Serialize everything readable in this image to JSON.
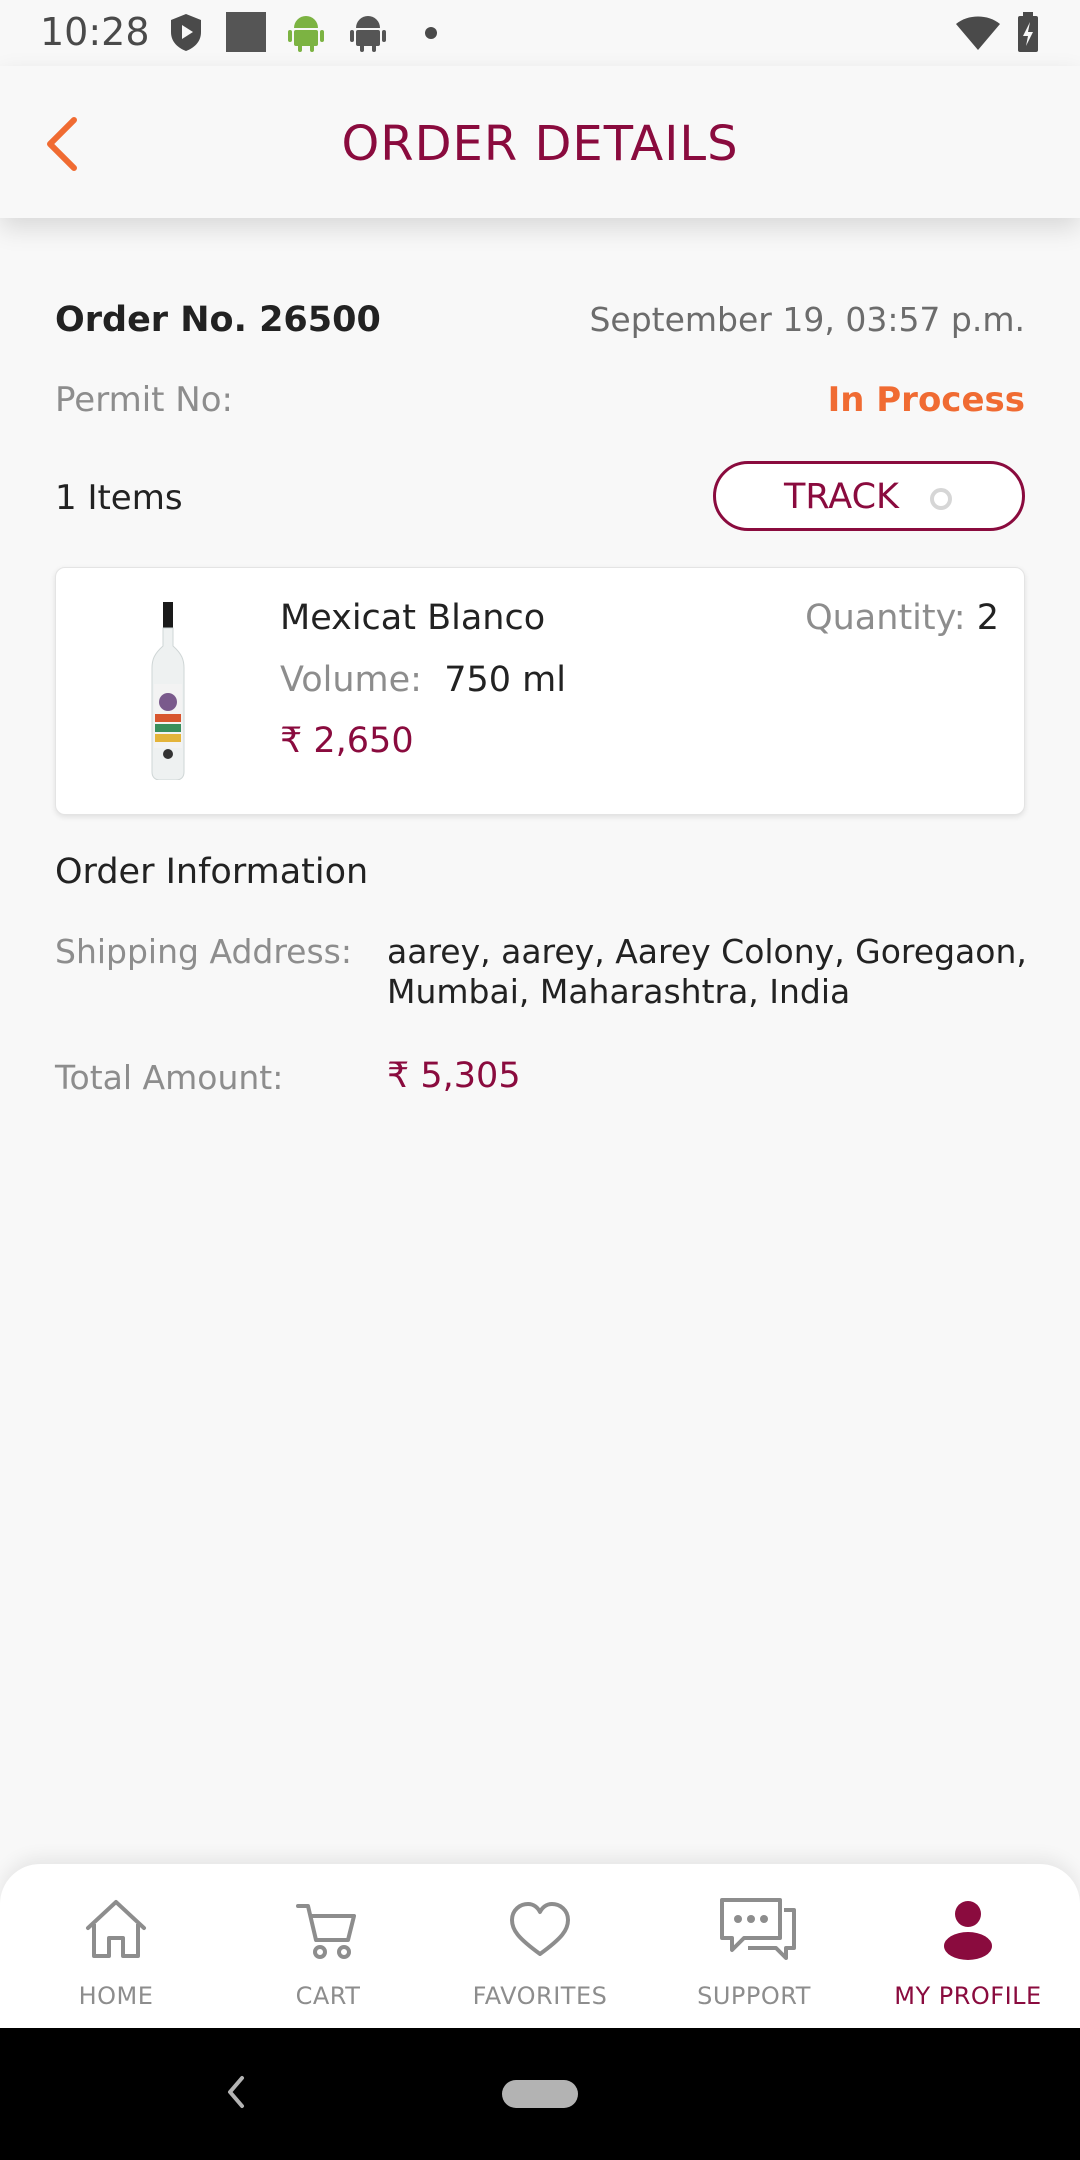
{
  "status_bar": {
    "time": "10:28"
  },
  "header": {
    "title": "ORDER DETAILS"
  },
  "order": {
    "number_label": "Order No. 26500",
    "date": "September 19, 03:57 p.m.",
    "permit_label": "Permit No:",
    "status": "In Process",
    "items_count": "1 Items",
    "track_label": "TRACK"
  },
  "item": {
    "name": "Mexicat  Blanco",
    "volume_label": "Volume:",
    "volume_value": "750 ml",
    "price": "₹ 2,650",
    "quantity_label": "Quantity:",
    "quantity_value": "2"
  },
  "order_info": {
    "title": "Order Information",
    "shipping_label": "Shipping Address:",
    "shipping_value": "aarey, aarey, Aarey Colony, Goregaon, Mumbai, Maharashtra, India",
    "total_label": "Total Amount:",
    "total_value": "₹ 5,305"
  },
  "bottom_nav": {
    "items": [
      {
        "label": "HOME",
        "icon": "home-icon"
      },
      {
        "label": "CART",
        "icon": "cart-icon"
      },
      {
        "label": "FAVORITES",
        "icon": "heart-icon"
      },
      {
        "label": "SUPPORT",
        "icon": "chat-icon"
      },
      {
        "label": "MY PROFILE",
        "icon": "profile-icon"
      }
    ],
    "active_index": 4
  },
  "colors": {
    "brand": "#8a0b3e",
    "accent": "#f06b32",
    "muted": "#8d8d8d"
  }
}
